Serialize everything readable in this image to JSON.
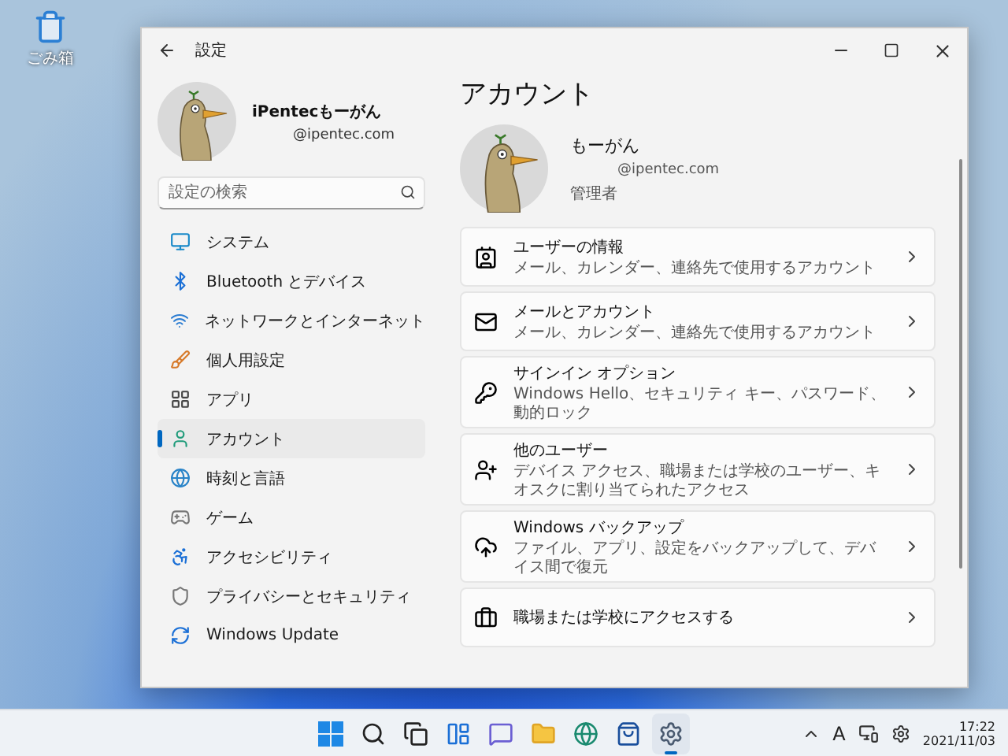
{
  "desktop_icons": [
    {
      "label": "ごみ箱"
    }
  ],
  "window": {
    "title": "設定"
  },
  "sidebar": {
    "profile": {
      "name": "iPentecもーがん",
      "email": "@ipentec.com"
    },
    "search": {
      "placeholder": "設定の検索"
    },
    "items": [
      {
        "label": "システム",
        "selected": false
      },
      {
        "label": "Bluetooth とデバイス",
        "selected": false
      },
      {
        "label": "ネットワークとインターネット",
        "selected": false
      },
      {
        "label": "個人用設定",
        "selected": false
      },
      {
        "label": "アプリ",
        "selected": false
      },
      {
        "label": "アカウント",
        "selected": true
      },
      {
        "label": "時刻と言語",
        "selected": false
      },
      {
        "label": "ゲーム",
        "selected": false
      },
      {
        "label": "アクセシビリティ",
        "selected": false
      },
      {
        "label": "プライバシーとセキュリティ",
        "selected": false
      },
      {
        "label": "Windows Update",
        "selected": false
      }
    ]
  },
  "content": {
    "title": "アカウント",
    "profile": {
      "name": "もーがん",
      "email": "@ipentec.com",
      "role": "管理者"
    },
    "cards": [
      {
        "title": "ユーザーの情報",
        "subtitle": "メール、カレンダー、連絡先で使用するアカウント"
      },
      {
        "title": "メールとアカウント",
        "subtitle": "メール、カレンダー、連絡先で使用するアカウント"
      },
      {
        "title": "サインイン オプション",
        "subtitle": "Windows Hello、セキュリティ キー、パスワード、動的ロック"
      },
      {
        "title": "他のユーザー",
        "subtitle": "デバイス アクセス、職場または学校のユーザー、キオスクに割り当てられたアクセス"
      },
      {
        "title": "Windows バックアップ",
        "subtitle": "ファイル、アプリ、設定をバックアップして、デバイス間で復元"
      },
      {
        "title": "職場または学校にアクセスする"
      }
    ]
  },
  "taskbar": {
    "apps": [
      {
        "active": false
      },
      {
        "active": false
      },
      {
        "active": false
      },
      {
        "active": false
      },
      {
        "active": false
      },
      {
        "active": false
      },
      {
        "active": false
      },
      {
        "active": false
      },
      {
        "active": true
      }
    ],
    "ime": "A",
    "time": "17:22",
    "date": "2021/11/03"
  }
}
